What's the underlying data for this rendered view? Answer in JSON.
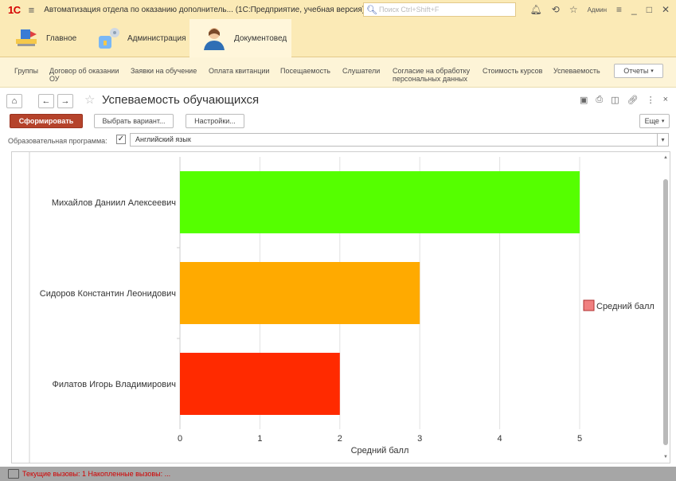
{
  "window": {
    "logo": "1С",
    "title": "Автоматизация отдела по оказанию дополнитель...  (1С:Предприятие, учебная версия)",
    "search_placeholder": "Поиск Ctrl+Shift+F",
    "user": "Админ"
  },
  "sections": [
    {
      "label": "Главное",
      "icon": "home-section-icon"
    },
    {
      "label": "Администрация",
      "icon": "admin-section-icon"
    },
    {
      "label": "Документовед",
      "icon": "user-section-icon",
      "active": true
    }
  ],
  "nav": [
    "Группы",
    "Договор об оказании ОУ",
    "Заявки на обучение",
    "Оплата квитанции",
    "Посещаемость",
    "Слушатели",
    "Согласие на обработку персональных данных",
    "Стоимость курсов",
    "Успеваемость"
  ],
  "reports_label": "Отчеты",
  "form": {
    "title": "Успеваемость обучающихся",
    "generate_label": "Сформировать",
    "choose_variant_label": "Выбрать вариант...",
    "settings_label": "Настройки...",
    "more_label": "Еще",
    "param_label": "Образовательная программа:",
    "param_checked": true,
    "param_value": "Английский язык"
  },
  "chart_data": {
    "type": "bar",
    "orientation": "horizontal",
    "categories": [
      "Михайлов Даниил Алексеевич",
      "Сидоров Константин Леонидович",
      "Филатов Игорь Владимирович"
    ],
    "series": [
      {
        "name": "Средний балл",
        "values": [
          5,
          3,
          2
        ]
      }
    ],
    "bar_colors": [
      "#55ff00",
      "#ffaa00",
      "#ff2a00"
    ],
    "legend_color": "#f08080",
    "xlabel": "Средний балл",
    "xlim": [
      0,
      5
    ],
    "xticks": [
      "0",
      "1",
      "2",
      "3",
      "4",
      "5"
    ],
    "grid": true,
    "legend_position": "right"
  },
  "status": {
    "text": "Текущие вызовы: 1   Накопленные вызовы: ..."
  }
}
